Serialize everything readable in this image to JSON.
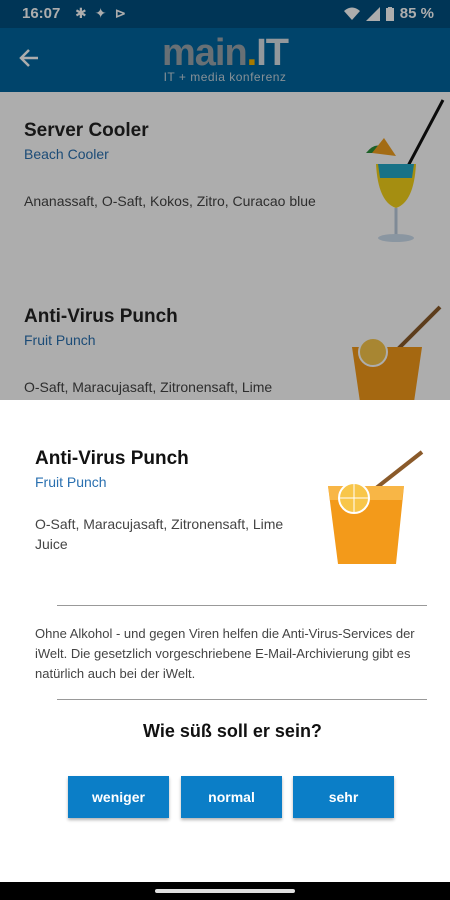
{
  "status_bar": {
    "time": "16:07",
    "battery": "85 %"
  },
  "app_bar": {
    "logo_main": "main",
    "logo_dot": ".",
    "logo_it": "IT",
    "logo_sub": "IT + media konferenz"
  },
  "list": [
    {
      "name": "Server Cooler",
      "type": "Beach Cooler",
      "ingredients": "Ananassaft, O-Saft, Kokos, Zitro, Curacao blue"
    },
    {
      "name": "Anti-Virus Punch",
      "type": "Fruit Punch",
      "ingredients": "O-Saft, Maracujasaft, Zitronensaft, Lime"
    }
  ],
  "sheet": {
    "name": "Anti-Virus Punch",
    "type": "Fruit Punch",
    "ingredients": "O-Saft, Maracujasaft, Zitronensaft, Lime Juice",
    "description": "Ohne Alkohol - und gegen Viren helfen die Anti-Virus-Services der iWelt. Die gesetzlich vorgeschriebene E-Mail-Archivierung gibt es natürlich auch bei der iWelt.",
    "question": "Wie süß soll er sein?",
    "buttons": [
      "weniger",
      "normal",
      "sehr"
    ]
  },
  "colors": {
    "status_bar": "#004e7f",
    "app_bar": "#00659e",
    "accent": "#0b7ec7",
    "link": "#2a70b0"
  }
}
